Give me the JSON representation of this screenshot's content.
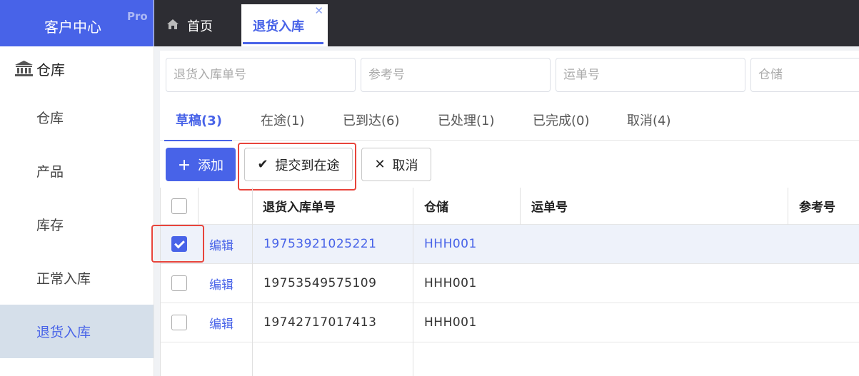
{
  "brand": {
    "name": "客户中心",
    "badge": "Pro"
  },
  "sidebar": {
    "group_label": "仓库",
    "items": [
      {
        "label": "仓库",
        "active": false
      },
      {
        "label": "产品",
        "active": false
      },
      {
        "label": "库存",
        "active": false
      },
      {
        "label": "正常入库",
        "active": false
      },
      {
        "label": "退货入库",
        "active": true
      }
    ]
  },
  "topbar": {
    "home_label": "首页",
    "current_tab": "退货入库"
  },
  "filters": {
    "return_no_placeholder": "退货入库单号",
    "reference_placeholder": "参考号",
    "waybill_placeholder": "运单号",
    "warehouse_placeholder": "仓储"
  },
  "status_tabs": [
    {
      "label": "草稿(3)",
      "active": true
    },
    {
      "label": "在途(1)",
      "active": false
    },
    {
      "label": "已到达(6)",
      "active": false
    },
    {
      "label": "已处理(1)",
      "active": false
    },
    {
      "label": "已完成(0)",
      "active": false
    },
    {
      "label": "取消(4)",
      "active": false
    }
  ],
  "toolbar": {
    "add_label": "添加",
    "submit_label": "提交到在途",
    "cancel_label": "取消"
  },
  "table": {
    "headers": {
      "return_no": "退货入库单号",
      "warehouse": "仓储",
      "waybill": "运单号",
      "reference": "参考号"
    },
    "rows": [
      {
        "checked": true,
        "edit": "编辑",
        "return_no": "19753921025221",
        "warehouse": "HHH001",
        "waybill": "",
        "reference": ""
      },
      {
        "checked": false,
        "edit": "编辑",
        "return_no": "19753549575109",
        "warehouse": "HHH001",
        "waybill": "",
        "reference": ""
      },
      {
        "checked": false,
        "edit": "编辑",
        "return_no": "19742717017413",
        "warehouse": "HHH001",
        "waybill": "",
        "reference": ""
      }
    ]
  },
  "colors": {
    "accent": "#4863e8",
    "sidebar_active_bg": "#d5dfea",
    "topbar_bg": "#2d2d33",
    "highlight": "#e8443b"
  }
}
